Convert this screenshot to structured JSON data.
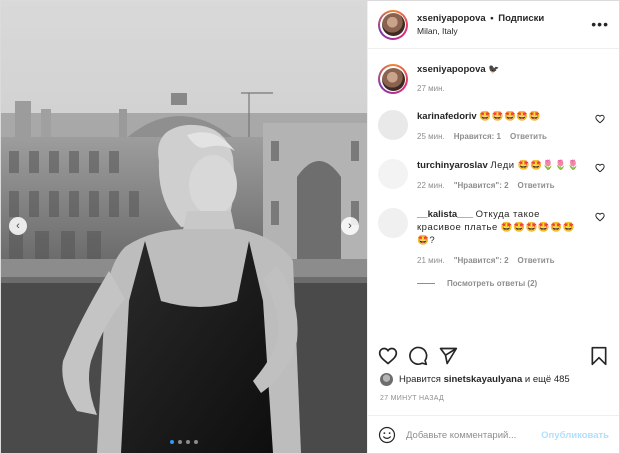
{
  "post": {
    "username": "xseniyapopova",
    "separator": "•",
    "follow_label": "Подписки",
    "location": "Milan, Italy",
    "more_icon": "more-horizontal-icon",
    "caption_text": "🐦‍⬛",
    "caption_time": "27 мин."
  },
  "comments": [
    {
      "username": "karinafedoriv",
      "text": "🤩🤩🤩🤩🤩",
      "time": "25 мин.",
      "likes": "Нравится: 1",
      "reply": "Ответить",
      "avatar_color": "#e9e9e9"
    },
    {
      "username": "turchinyaroslav",
      "text": "Леди 🤩🤩🌷🌷🌷",
      "time": "22 мин.",
      "likes": "\"Нравится\": 2",
      "reply": "Ответить",
      "avatar_color": "#f3f3f3"
    },
    {
      "username": "__kalista___",
      "text": "Откуда такое красивое платье 🤩🤩🤩🤩🤩🤩🤩?",
      "time": "21 мин.",
      "likes": "\"Нравится\": 2",
      "reply": "Ответить",
      "avatar_color": "#f0f0f0",
      "view_replies": "Посмотреть ответы (2)"
    }
  ],
  "actions": {
    "like_icon": "heart-icon",
    "comment_icon": "comment-icon",
    "share_icon": "share-icon",
    "save_icon": "bookmark-icon"
  },
  "likes": {
    "prefix": "Нравится",
    "user": "sinetskayaulyana",
    "suffix": "и ещё 485"
  },
  "timestamp": "27 МИНУТ НАЗАД",
  "add_comment": {
    "placeholder": "Добавьте комментарий...",
    "publish_label": "Опубликовать"
  },
  "carousel": {
    "prev_glyph": "‹",
    "next_glyph": "›",
    "slide_count": 4,
    "active_index": 0
  },
  "colors": {
    "link_blue": "#3897f0",
    "publish_disabled": "#b2dffc",
    "meta_gray": "#8e8e8e"
  }
}
